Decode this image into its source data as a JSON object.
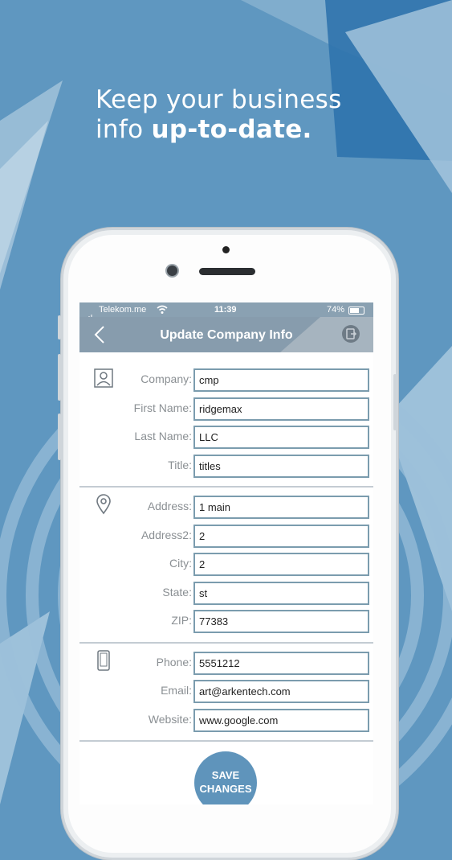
{
  "promo": {
    "line1": "Keep your business",
    "line2_prefix": "info",
    "line2_bold": "up-to-date."
  },
  "status_bar": {
    "carrier": "Telekom.me",
    "time": "11:39",
    "battery": "74%"
  },
  "nav": {
    "title": "Update Company Info"
  },
  "company_section": {
    "fields": [
      {
        "label": "Company:",
        "value": "cmp"
      },
      {
        "label": "First Name:",
        "value": "ridgemax"
      },
      {
        "label": "Last Name:",
        "value": "LLC"
      },
      {
        "label": "Title:",
        "value": "titles"
      }
    ]
  },
  "address_section": {
    "fields": [
      {
        "label": "Address:",
        "value": "1 main"
      },
      {
        "label": "Address2:",
        "value": "2"
      },
      {
        "label": "City:",
        "value": "2"
      },
      {
        "label": "State:",
        "value": "st"
      },
      {
        "label": "ZIP:",
        "value": "77383"
      }
    ]
  },
  "contact_section": {
    "fields": [
      {
        "label": "Phone:",
        "value": "5551212"
      },
      {
        "label": "Email:",
        "value": "art@arkentech.com"
      },
      {
        "label": "Website:",
        "value": "www.google.com"
      }
    ]
  },
  "save_button": {
    "line1": "SAVE",
    "line2": "CHANGES"
  },
  "colors": {
    "background": "#5f97c0",
    "navbar": "#879cad",
    "field_border": "#7b9cae",
    "save": "#5f94bb"
  }
}
